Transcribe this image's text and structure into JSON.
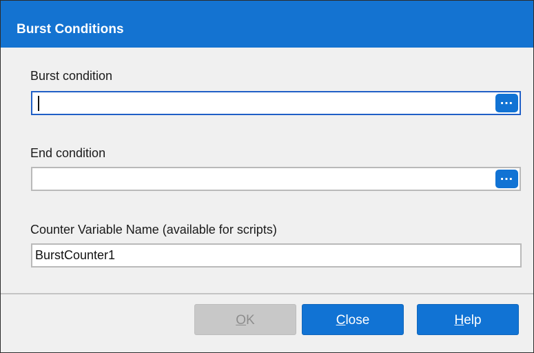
{
  "dialog": {
    "title": "Burst Conditions"
  },
  "fields": {
    "burst_condition": {
      "label": "Burst condition",
      "value": "",
      "ellipsis": "…"
    },
    "end_condition": {
      "label": "End condition",
      "value": "",
      "ellipsis": "…"
    },
    "counter_variable": {
      "label": "Counter Variable Name (available for scripts)",
      "value": "BurstCounter1"
    }
  },
  "buttons": {
    "ok": {
      "mnemonic": "O",
      "rest": "K",
      "enabled": false
    },
    "close": {
      "mnemonic": "C",
      "rest": "lose",
      "enabled": true
    },
    "help": {
      "mnemonic": "H",
      "rest": "elp",
      "enabled": true
    }
  },
  "colors": {
    "title_bar": "#1473d1",
    "primary_button": "#1173d4",
    "disabled_button": "#c8c8c8",
    "focus_border": "#1f5fc6"
  }
}
